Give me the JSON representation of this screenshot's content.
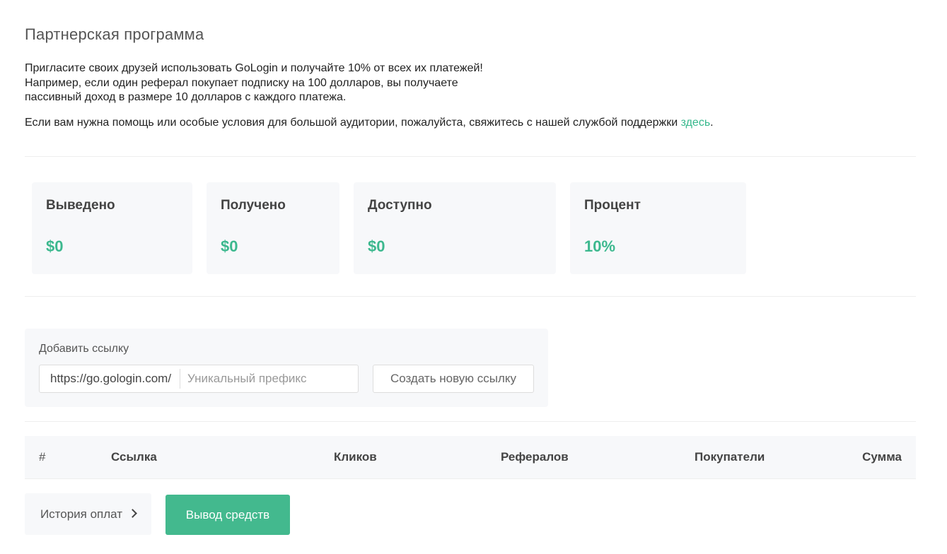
{
  "page": {
    "title": "Партнерская программа",
    "intro": "Пригласите своих друзей использовать GoLogin и получайте 10% от всех их платежей! Например, если один реферал покупает подписку на 100 долларов, вы получаете пассивный доход в размере 10 долларов с каждого платежа.",
    "help_text": "Если вам нужна помощь или особые условия для большой аудитории, пожалуйста, свяжитесь с нашей службой поддержки ",
    "help_link": "здесь",
    "help_end": "."
  },
  "stats": {
    "withdrawn": {
      "label": "Выведено",
      "value": "$0"
    },
    "received": {
      "label": "Получено",
      "value": "$0"
    },
    "available": {
      "label": "Доступно",
      "value": "$0"
    },
    "percent": {
      "label": "Процент",
      "value": "10%"
    }
  },
  "link_form": {
    "label": "Добавить ссылку",
    "url_prefix": "https://go.gologin.com/",
    "prefix_placeholder": "Уникальный префикс",
    "create_button": "Создать новую ссылку"
  },
  "table": {
    "columns": [
      "#",
      "Ссылка",
      "Кликов",
      "Рефералов",
      "Покупатели",
      "Сумма"
    ]
  },
  "actions": {
    "history_button": "История оплат",
    "withdraw_button": "Вывод средств"
  },
  "colors": {
    "accent": "#3cb88e",
    "card_background": "#f7f8fa"
  }
}
